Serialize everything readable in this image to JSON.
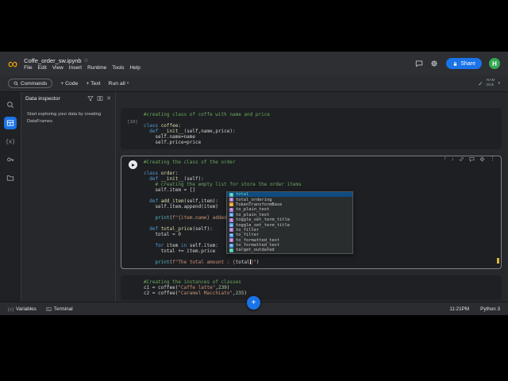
{
  "header": {
    "logo_glyph": "∞",
    "title": "Coffe_order_sw.ipynb",
    "menus": [
      "File",
      "Edit",
      "View",
      "Insert",
      "Runtime",
      "Tools",
      "Help"
    ],
    "share_label": "Share",
    "avatar_letter": "H"
  },
  "toolbar": {
    "commands": "Commands",
    "add_code": "+ Code",
    "add_text": "+ Text",
    "run_all": "Run all",
    "ram": "RAM",
    "disk": "Disk"
  },
  "rail": {
    "items": [
      {
        "name": "search",
        "icon": "search",
        "active": false
      },
      {
        "name": "data-inspector",
        "icon": "table",
        "active": true
      },
      {
        "name": "variable-inspector",
        "icon": "braces",
        "active": false
      },
      {
        "name": "secrets",
        "icon": "key",
        "active": false
      },
      {
        "name": "files",
        "icon": "folder",
        "active": false
      }
    ]
  },
  "panel": {
    "title": "Data inspector",
    "empty_text": "Start exploring your data by creating DataFrames."
  },
  "notebook": {
    "cell_toolbar_icons": [
      "arrow-up",
      "arrow-down",
      "link",
      "comment",
      "settings",
      "more-vert"
    ],
    "cells": [
      {
        "exec": "[10]",
        "focused": false,
        "lines": [
          [
            [
              "c",
              "#creating class of coffe with name and price"
            ]
          ],
          [],
          [
            [
              "k",
              "class "
            ],
            [
              "d",
              "coffee"
            ],
            [
              "v",
              ":"
            ]
          ],
          [
            [
              "v",
              "  "
            ],
            [
              "k",
              "def "
            ],
            [
              "d",
              "__init__"
            ],
            [
              "v",
              "(self,name,price):"
            ]
          ],
          [
            [
              "v",
              "    self.name=name"
            ]
          ],
          [
            [
              "v",
              "    self.price=price"
            ]
          ]
        ]
      },
      {
        "exec": "",
        "focused": true,
        "lines": [
          [
            [
              "c",
              "#Creating the class of the order"
            ]
          ],
          [],
          [
            [
              "k",
              "class "
            ],
            [
              "d",
              "order"
            ],
            [
              "v",
              ":"
            ]
          ],
          [
            [
              "v",
              "  "
            ],
            [
              "k",
              "def "
            ],
            [
              "d",
              "__init__"
            ],
            [
              "v",
              "(self):"
            ]
          ],
          [
            [
              "v",
              "    "
            ],
            [
              "c",
              "# creating the empty list for store the order items"
            ]
          ],
          [
            [
              "v",
              "    self.item = []"
            ]
          ],
          [],
          [
            [
              "v",
              "  "
            ],
            [
              "k",
              "def "
            ],
            [
              "d",
              "add_item"
            ],
            [
              "v",
              "(self,item):"
            ]
          ],
          [
            [
              "v",
              "    self.item.append(item)"
            ]
          ],
          [],
          [
            [
              "v",
              "    "
            ],
            [
              "b",
              "print"
            ],
            [
              "v",
              "("
            ],
            [
              "s",
              "f\"{item.name} added succ"
            ]
          ],
          [],
          [
            [
              "v",
              "  "
            ],
            [
              "k",
              "def "
            ],
            [
              "d",
              "total_price"
            ],
            [
              "v",
              "(self):"
            ]
          ],
          [
            [
              "v",
              "    total = "
            ],
            [
              "n",
              "0"
            ]
          ],
          [],
          [
            [
              "v",
              "    "
            ],
            [
              "k",
              "for"
            ],
            [
              "v",
              " item "
            ],
            [
              "k",
              "in"
            ],
            [
              "v",
              " self.item:"
            ]
          ],
          [
            [
              "v",
              "      total += item.price"
            ]
          ],
          [],
          [
            [
              "v",
              "    "
            ],
            [
              "b",
              "print"
            ],
            [
              "v",
              "("
            ],
            [
              "s",
              "f\"The total amount : {"
            ],
            [
              "v",
              "total"
            ],
            [
              "caret",
              ""
            ],
            [
              "s",
              "}\""
            ],
            [
              "v",
              ")"
            ]
          ]
        ]
      },
      {
        "exec": "",
        "focused": false,
        "lines": [
          [
            [
              "c",
              "#Creating the instances of classes"
            ]
          ],
          [
            [
              "v",
              "c1 = coffee("
            ],
            [
              "s",
              "\"Caffe latte\""
            ],
            [
              "v",
              ","
            ],
            [
              "n",
              "239"
            ],
            [
              "v",
              ")"
            ]
          ],
          [
            [
              "v",
              "c2 = coffee("
            ],
            [
              "s",
              "\"Caramel Macchiato\""
            ],
            [
              "v",
              ","
            ],
            [
              "n",
              "235"
            ],
            [
              "v",
              ")"
            ]
          ]
        ]
      }
    ],
    "autocomplete": {
      "items": [
        {
          "icon": "v",
          "label": "total",
          "selected": true
        },
        {
          "icon": "f",
          "label": "total_ordering"
        },
        {
          "icon": "c",
          "label": "TokenTransformBase"
        },
        {
          "icon": "f",
          "label": "to_plain_text"
        },
        {
          "icon": "m",
          "label": "to_plain_text"
        },
        {
          "icon": "f",
          "label": "toggle_set_term_title"
        },
        {
          "icon": "m",
          "label": "toggle_set_term_title"
        },
        {
          "icon": "f",
          "label": "to_filter"
        },
        {
          "icon": "m",
          "label": "to_filter"
        },
        {
          "icon": "f",
          "label": "to_formatted_text"
        },
        {
          "icon": "m",
          "label": "to_formatted_text"
        },
        {
          "icon": "v",
          "label": "target_outdated"
        }
      ]
    }
  },
  "statusbar": {
    "variables": "Variables",
    "terminal": "Terminal",
    "time": "11:21PM",
    "kernel": "Python 3"
  },
  "colors": {
    "accent_blue": "#1a73e8",
    "logo_orange": "#f9ab00",
    "avatar_green": "#34a853",
    "scroll_marker_yellow": "#d7ba3d"
  }
}
